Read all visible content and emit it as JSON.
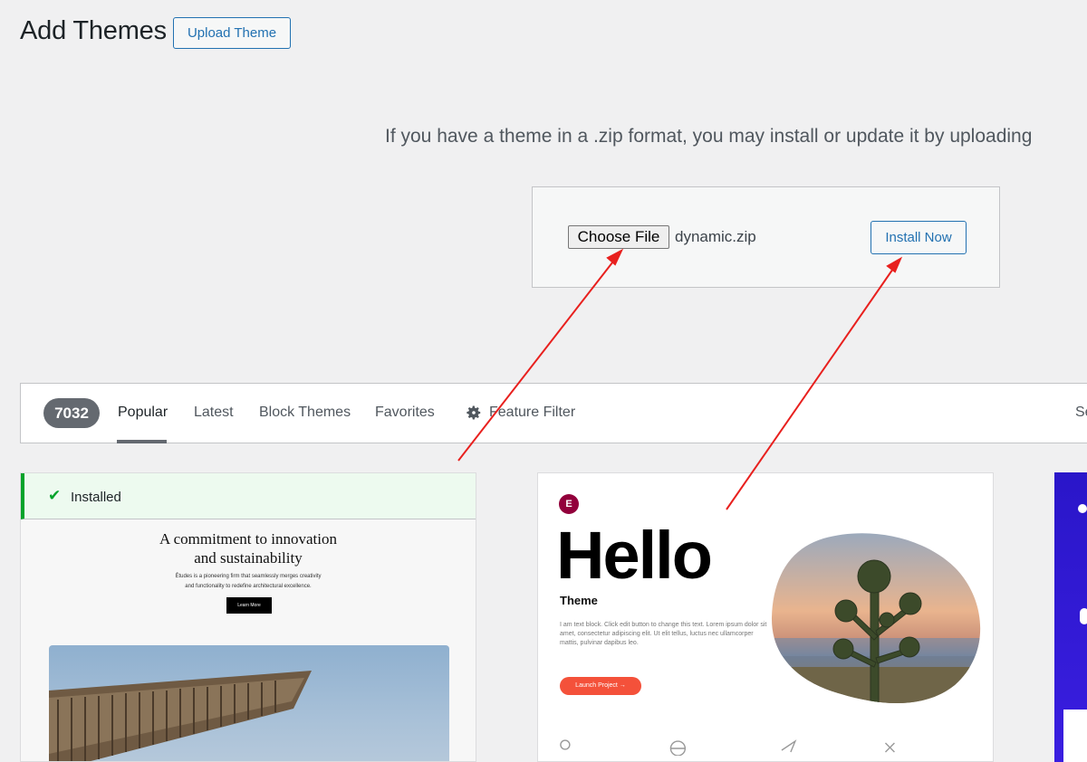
{
  "header": {
    "title": "Add Themes",
    "upload_button": "Upload Theme"
  },
  "upload": {
    "help_text": "If you have a theme in a .zip format, you may install or update it by uploading",
    "choose_file_label": "Choose File",
    "file_name": "dynamic.zip",
    "install_button": "Install Now"
  },
  "filter": {
    "count": "7032",
    "tabs": [
      "Popular",
      "Latest",
      "Block Themes",
      "Favorites"
    ],
    "active_tab": "Popular",
    "feature_filter": "Feature Filter",
    "search_stub": "Se"
  },
  "themes": [
    {
      "status": "Installed",
      "preview_heading_line1": "A commitment to innovation",
      "preview_heading_line2": "and sustainability",
      "preview_sub_line1": "Études is a pioneering firm that seamlessly merges creativity",
      "preview_sub_line2": "and functionality to redefine architectural excellence.",
      "preview_button": "Learn More"
    },
    {
      "logo": "E",
      "preview_title": "Hello",
      "preview_subtitle": "Theme",
      "preview_text": "I am text block. Click edit button to change this text. Lorem ipsum dolor sit amet, consectetur adipiscing elit. Ut elit tellus, luctus nec ullamcorper mattis, pulvinar dapibus leo.",
      "preview_button": "Launch Project  →"
    }
  ],
  "colors": {
    "accent": "#2271b1",
    "installed_green": "#00a32a",
    "annotation_arrow": "#e8201e"
  }
}
